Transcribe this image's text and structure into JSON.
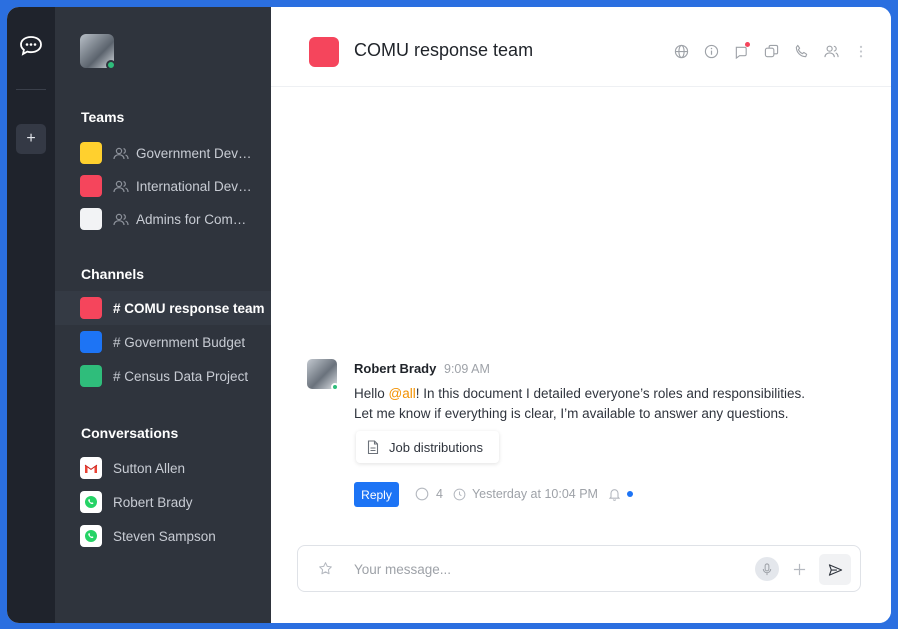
{
  "colors": {
    "accent": "#1d74f5",
    "sidebar_bg": "#2f343d",
    "rail_bg": "#1f232c",
    "mention": "#f29100"
  },
  "rail": {
    "add_label": "+"
  },
  "sidebar": {
    "teams_title": "Teams",
    "teams": [
      {
        "label": "Government Development",
        "color": "#ffd02e"
      },
      {
        "label": "International Development",
        "color": "#f5455c"
      },
      {
        "label": "Admins for Community",
        "color": "#f2f3f5"
      }
    ],
    "channels_title": "Channels",
    "channels": [
      {
        "label": "# COMU response team",
        "color": "#f5455c",
        "active": true
      },
      {
        "label": "# Government Budget",
        "color": "#1d74f5"
      },
      {
        "label": "# Census Data Project",
        "color": "#2fbd7b"
      }
    ],
    "conversations_title": "Conversations",
    "conversations": [
      {
        "label": "Sutton Allen",
        "icon": "gmail-icon"
      },
      {
        "label": "Robert Brady",
        "icon": "whatsapp-icon"
      },
      {
        "label": "Steven Sampson",
        "icon": "whatsapp-icon"
      }
    ]
  },
  "header": {
    "title": "COMU response team",
    "icons": [
      "globe-icon",
      "info-icon",
      "threads-icon",
      "discussion-icon",
      "call-icon",
      "members-icon",
      "kebab-icon"
    ]
  },
  "message": {
    "author": "Robert Brady",
    "time": "9:09 AM",
    "text_pre": "Hello ",
    "mention": "@all",
    "text_post": "! In this document I detailed everyone’s roles and responsibilities.",
    "text_line2": "Let me know if everything is clear, I’m available to answer any questions.",
    "attachment": "Job distributions",
    "reply_label": "Reply",
    "reply_count": "4",
    "last_reply": "Yesterday at 10:04 PM"
  },
  "composer": {
    "placeholder": "Your message..."
  }
}
